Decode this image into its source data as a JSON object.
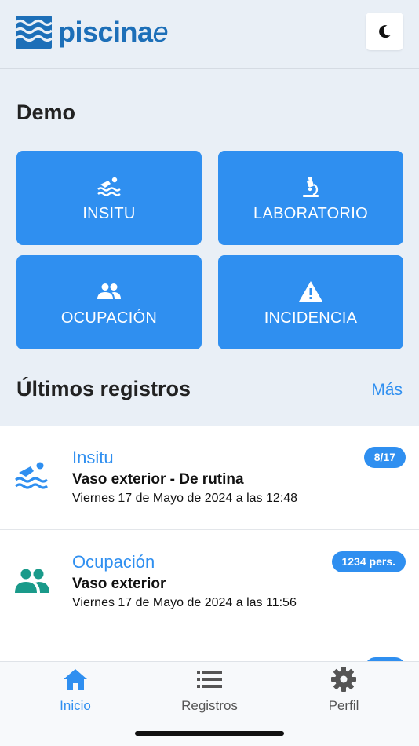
{
  "brand": {
    "name": "piscina",
    "suffix": "e",
    "color": "#1d6fb8"
  },
  "header": {
    "theme_toggle_icon": "moon-icon"
  },
  "site": {
    "title": "Demo"
  },
  "actions": [
    {
      "label": "INSITU",
      "icon": "swimmer-icon"
    },
    {
      "label": "LABORATORIO",
      "icon": "microscope-icon"
    },
    {
      "label": "OCUPACIÓN",
      "icon": "people-icon"
    },
    {
      "label": "INCIDENCIA",
      "icon": "warning-icon"
    }
  ],
  "recent": {
    "title": "Últimos registros",
    "more_label": "Más",
    "items": [
      {
        "type": "Insitu",
        "place": "Vaso exterior - De rutina",
        "date": "Viernes 17 de Mayo de 2024 a las 12:48",
        "badge": "8/17",
        "icon": "swimmer-icon"
      },
      {
        "type": "Ocupación",
        "place": "Vaso exterior",
        "date": "Viernes 17 de Mayo de 2024 a las 11:56",
        "badge": "1234 pers.",
        "icon": "people-icon"
      }
    ]
  },
  "tabs": [
    {
      "label": "Inicio",
      "icon": "home-icon",
      "active": true
    },
    {
      "label": "Registros",
      "icon": "list-icon",
      "active": false
    },
    {
      "label": "Perfil",
      "icon": "gear-icon",
      "active": false
    }
  ],
  "colors": {
    "accent": "#2f8ff0",
    "background": "#e9eff6",
    "teal": "#1a9a8a"
  }
}
